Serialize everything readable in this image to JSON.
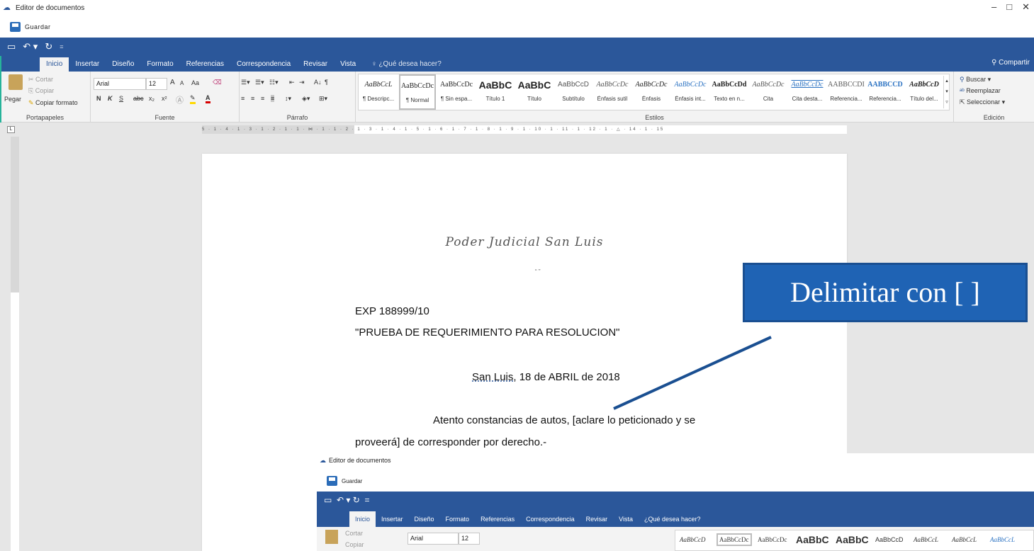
{
  "window": {
    "title": "Editor de documentos",
    "minimize": "–",
    "maximize": "□",
    "close": "✕"
  },
  "toolbar": {
    "save_label": "Guardar"
  },
  "qat": {
    "icons": [
      "save-icon",
      "undo-icon",
      "redo-icon",
      "customize-icon"
    ]
  },
  "tabs": [
    "Inicio",
    "Insertar",
    "Diseño",
    "Formato",
    "Referencias",
    "Correspondencia",
    "Revisar",
    "Vista"
  ],
  "tell_me": "¿Qué desea hacer?",
  "share_label": "Compartir",
  "clipboard": {
    "paste": "Pegar",
    "cut": "Cortar",
    "copy": "Copiar",
    "format_painter": "Copiar formato",
    "group": "Portapapeles"
  },
  "font": {
    "name": "Arial",
    "size": "12",
    "bold": "N",
    "italic": "K",
    "underline": "S",
    "strike": "abc",
    "sub": "x₂",
    "sup": "x²",
    "change_case": "Aa",
    "grow": "A",
    "shrink": "A",
    "group": "Fuente"
  },
  "paragraph": {
    "sort": "A↓",
    "marks": "¶",
    "group": "Párrafo"
  },
  "styles": {
    "group": "Estilos",
    "items": [
      {
        "sample": "AaBbCcL",
        "name": "¶ Descripc..."
      },
      {
        "sample": "AaBbCcDc",
        "name": "¶ Normal"
      },
      {
        "sample": "AaBbCcDc",
        "name": "¶ Sin espa..."
      },
      {
        "sample": "AaBbC",
        "name": "Título 1"
      },
      {
        "sample": "AaBbC",
        "name": "Título"
      },
      {
        "sample": "AaBbCcD",
        "name": "Subtítulo"
      },
      {
        "sample": "AaBbCcDc",
        "name": "Énfasis sutil"
      },
      {
        "sample": "AaBbCcDc",
        "name": "Énfasis"
      },
      {
        "sample": "AaBbCcDc",
        "name": "Énfasis int..."
      },
      {
        "sample": "AaBbCcDd",
        "name": "Texto en n..."
      },
      {
        "sample": "AaBbCcDc",
        "name": "Cita"
      },
      {
        "sample": "AaBbCcDc",
        "name": "Cita desta..."
      },
      {
        "sample": "AABBCCDI",
        "name": "Referencia..."
      },
      {
        "sample": "AABBCCD",
        "name": "Referencia..."
      },
      {
        "sample": "AaBbCcD",
        "name": "Título del..."
      }
    ]
  },
  "editing": {
    "find": "Buscar",
    "replace": "Reemplazar",
    "select": "Seleccionar",
    "group": "Edición"
  },
  "ruler": {
    "corner": "L",
    "ticks": "5 · 1 · 4 · 1 · 3 · 1 · 2 · 1 · 1 · ⋈ · 1 · 1 · 2 · 1 · 3 · 1 · 4 · 1 · 5 · 1 · 6 · 1 · 7 · 1 · 8 · 1 · 9 · 1 · 10 · 1 · 11 · 1 · 12 · 1 · △ · 14 · 1 · 15"
  },
  "document": {
    "letterhead": "Poder Judicial San Luis",
    "quotes": "“ ”",
    "exp": "EXP 188999/10",
    "caption": "\"PRUEBA DE REQUERIMIENTO PARA RESOLUCION\"",
    "date_city": "San Luis,",
    "date_rest": " 18 de ABRIL  de 2018",
    "body1": "Atento constancias de autos, [aclare lo peticionado y se",
    "body2": "proveerá] de corresponder por derecho.-"
  },
  "callout": {
    "text": "Delimitar con [ ]",
    "color": "#1f63b4"
  },
  "inset": {
    "title": "Editor de documentos",
    "save_label": "Guardar",
    "tabs": [
      "Inicio",
      "Insertar",
      "Diseño",
      "Formato",
      "Referencias",
      "Correspondencia",
      "Revisar",
      "Vista"
    ],
    "tell_me": "¿Qué desea hacer?",
    "font": "Arial",
    "size": "12",
    "cut": "Cortar",
    "copy": "Copiar",
    "styles": [
      "AaBbCcD",
      "AaBbCcDc",
      "AaBbCcDc",
      "AaBbC",
      "AaBbC",
      "AaBbCcD",
      "AaBbCcL",
      "AaBbCcL",
      "AaBbCcL"
    ]
  },
  "colors": {
    "accent": "#2b579a",
    "ribbon": "#f3f3f3",
    "canvas": "#e6e6e6"
  }
}
